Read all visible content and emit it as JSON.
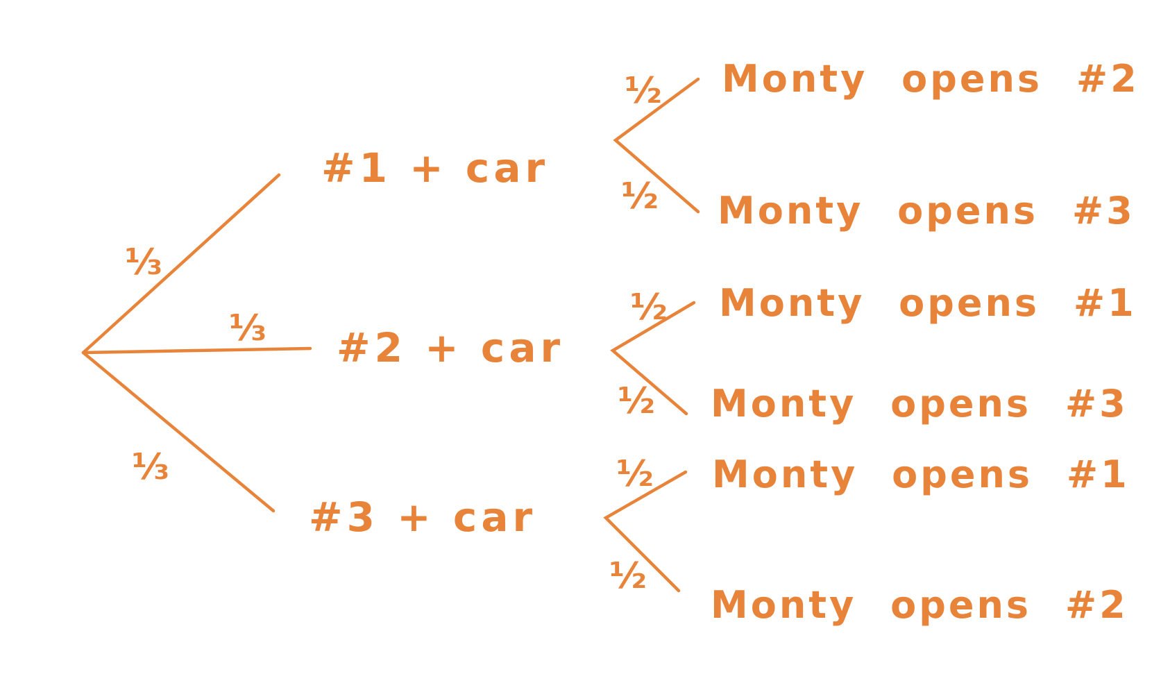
{
  "tree": {
    "first_level": [
      {
        "probability": "⅓",
        "label": "#1 + car"
      },
      {
        "probability": "⅓",
        "label": "#2 + car"
      },
      {
        "probability": "⅓",
        "label": "#3 + car"
      }
    ],
    "second_level": [
      {
        "probability": "½",
        "label": "Monty opens #2"
      },
      {
        "probability": "½",
        "label": "Monty opens #3"
      },
      {
        "probability": "½",
        "label": "Monty opens #1"
      },
      {
        "probability": "½",
        "label": "Monty opens #3"
      },
      {
        "probability": "½",
        "label": "Monty opens #1"
      },
      {
        "probability": "½",
        "label": "Monty opens #2"
      }
    ]
  },
  "colors": {
    "ink": "#E8833A",
    "background": "#FFFFFF"
  }
}
